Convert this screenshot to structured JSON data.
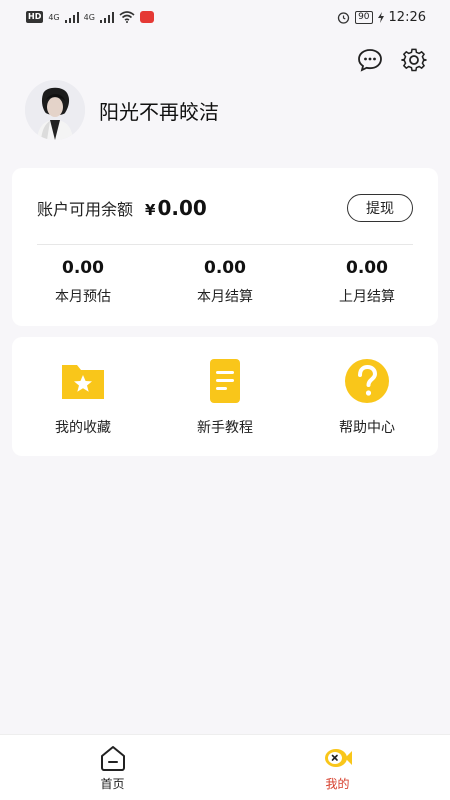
{
  "status_bar": {
    "badge": "HD",
    "signal_1": "4G",
    "signal_2": "4G",
    "battery": "90",
    "time": "12:26"
  },
  "header": {
    "icons": [
      "message-icon",
      "gear-icon"
    ]
  },
  "profile": {
    "username": "阳光不再皎洁"
  },
  "balance": {
    "label": "账户可用余额",
    "currency": "¥",
    "amount": "0.00",
    "withdraw_label": "提现",
    "stats": [
      {
        "value": "0.00",
        "label": "本月预估"
      },
      {
        "value": "0.00",
        "label": "本月结算"
      },
      {
        "value": "0.00",
        "label": "上月结算"
      }
    ]
  },
  "menu": {
    "items": [
      {
        "label": "我的收藏",
        "icon": "star-folder-icon"
      },
      {
        "label": "新手教程",
        "icon": "document-icon"
      },
      {
        "label": "帮助中心",
        "icon": "question-icon"
      }
    ]
  },
  "tabs": [
    {
      "label": "首页",
      "icon": "home-icon",
      "active": false
    },
    {
      "label": "我的",
      "icon": "fish-icon",
      "active": true
    }
  ],
  "colors": {
    "accent_yellow": "#f9c61a",
    "active_tab": "#d63d2a",
    "background": "#f7f6f9"
  }
}
